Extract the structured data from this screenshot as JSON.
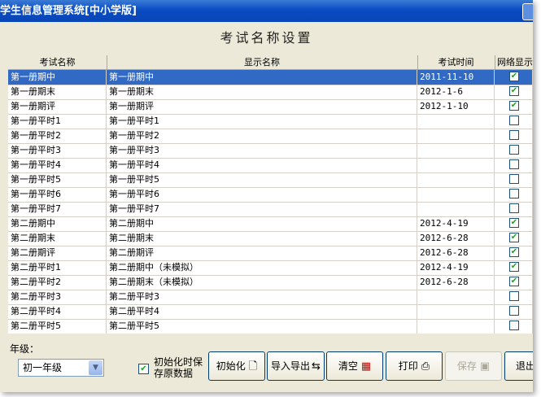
{
  "window": {
    "title": "学生信息管理系统[中小学版]"
  },
  "page": {
    "heading": "考试名称设置"
  },
  "columns": [
    "考试名称",
    "显示名称",
    "考试时间",
    "网络显示"
  ],
  "rows": [
    {
      "name": "第一册期中",
      "display": "第一册期中",
      "date": "2011-11-10",
      "net": true
    },
    {
      "name": "第一册期末",
      "display": "第一册期末",
      "date": "2012-1-6",
      "net": true
    },
    {
      "name": "第一册期评",
      "display": "第一册期评",
      "date": "2012-1-10",
      "net": true
    },
    {
      "name": "第一册平时1",
      "display": "第一册平时1",
      "date": "",
      "net": false
    },
    {
      "name": "第一册平时2",
      "display": "第一册平时2",
      "date": "",
      "net": false
    },
    {
      "name": "第一册平时3",
      "display": "第一册平时3",
      "date": "",
      "net": false
    },
    {
      "name": "第一册平时4",
      "display": "第一册平时4",
      "date": "",
      "net": false
    },
    {
      "name": "第一册平时5",
      "display": "第一册平时5",
      "date": "",
      "net": false
    },
    {
      "name": "第一册平时6",
      "display": "第一册平时6",
      "date": "",
      "net": false
    },
    {
      "name": "第一册平时7",
      "display": "第一册平时7",
      "date": "",
      "net": false
    },
    {
      "name": "第二册期中",
      "display": "第二册期中",
      "date": "2012-4-19",
      "net": true
    },
    {
      "name": "第二册期末",
      "display": "第二册期末",
      "date": "2012-6-28",
      "net": true
    },
    {
      "name": "第二册期评",
      "display": "第二册期评",
      "date": "2012-6-28",
      "net": true
    },
    {
      "name": "第二册平时1",
      "display": "第二册期中（未模拟）",
      "date": "2012-4-19",
      "net": true
    },
    {
      "name": "第二册平时2",
      "display": "第二册期末（未模拟）",
      "date": "2012-6-28",
      "net": true
    },
    {
      "name": "第二册平时3",
      "display": "第二册平时3",
      "date": "",
      "net": false
    },
    {
      "name": "第二册平时4",
      "display": "第二册平时4",
      "date": "",
      "net": false
    },
    {
      "name": "第二册平时5",
      "display": "第二册平时5",
      "date": "",
      "net": false
    }
  ],
  "selected_row": 0,
  "grade": {
    "label": "年级：",
    "value": "初一年级"
  },
  "keep_original": {
    "label": "初始化时保存原数据",
    "checked": true
  },
  "buttons": {
    "init": "初始化",
    "import_export": "导入导出",
    "clear": "清空",
    "print": "打印",
    "save": "保存",
    "exit": "退出"
  },
  "icons": {
    "init": "document-icon",
    "import_export": "import-export-icon",
    "clear": "clear-table-icon",
    "print": "printer-icon",
    "save": "floppy-disk-icon"
  },
  "colors": {
    "titlebar": "#0a4cc4",
    "selection": "#316ac5",
    "check": "#21a121"
  }
}
